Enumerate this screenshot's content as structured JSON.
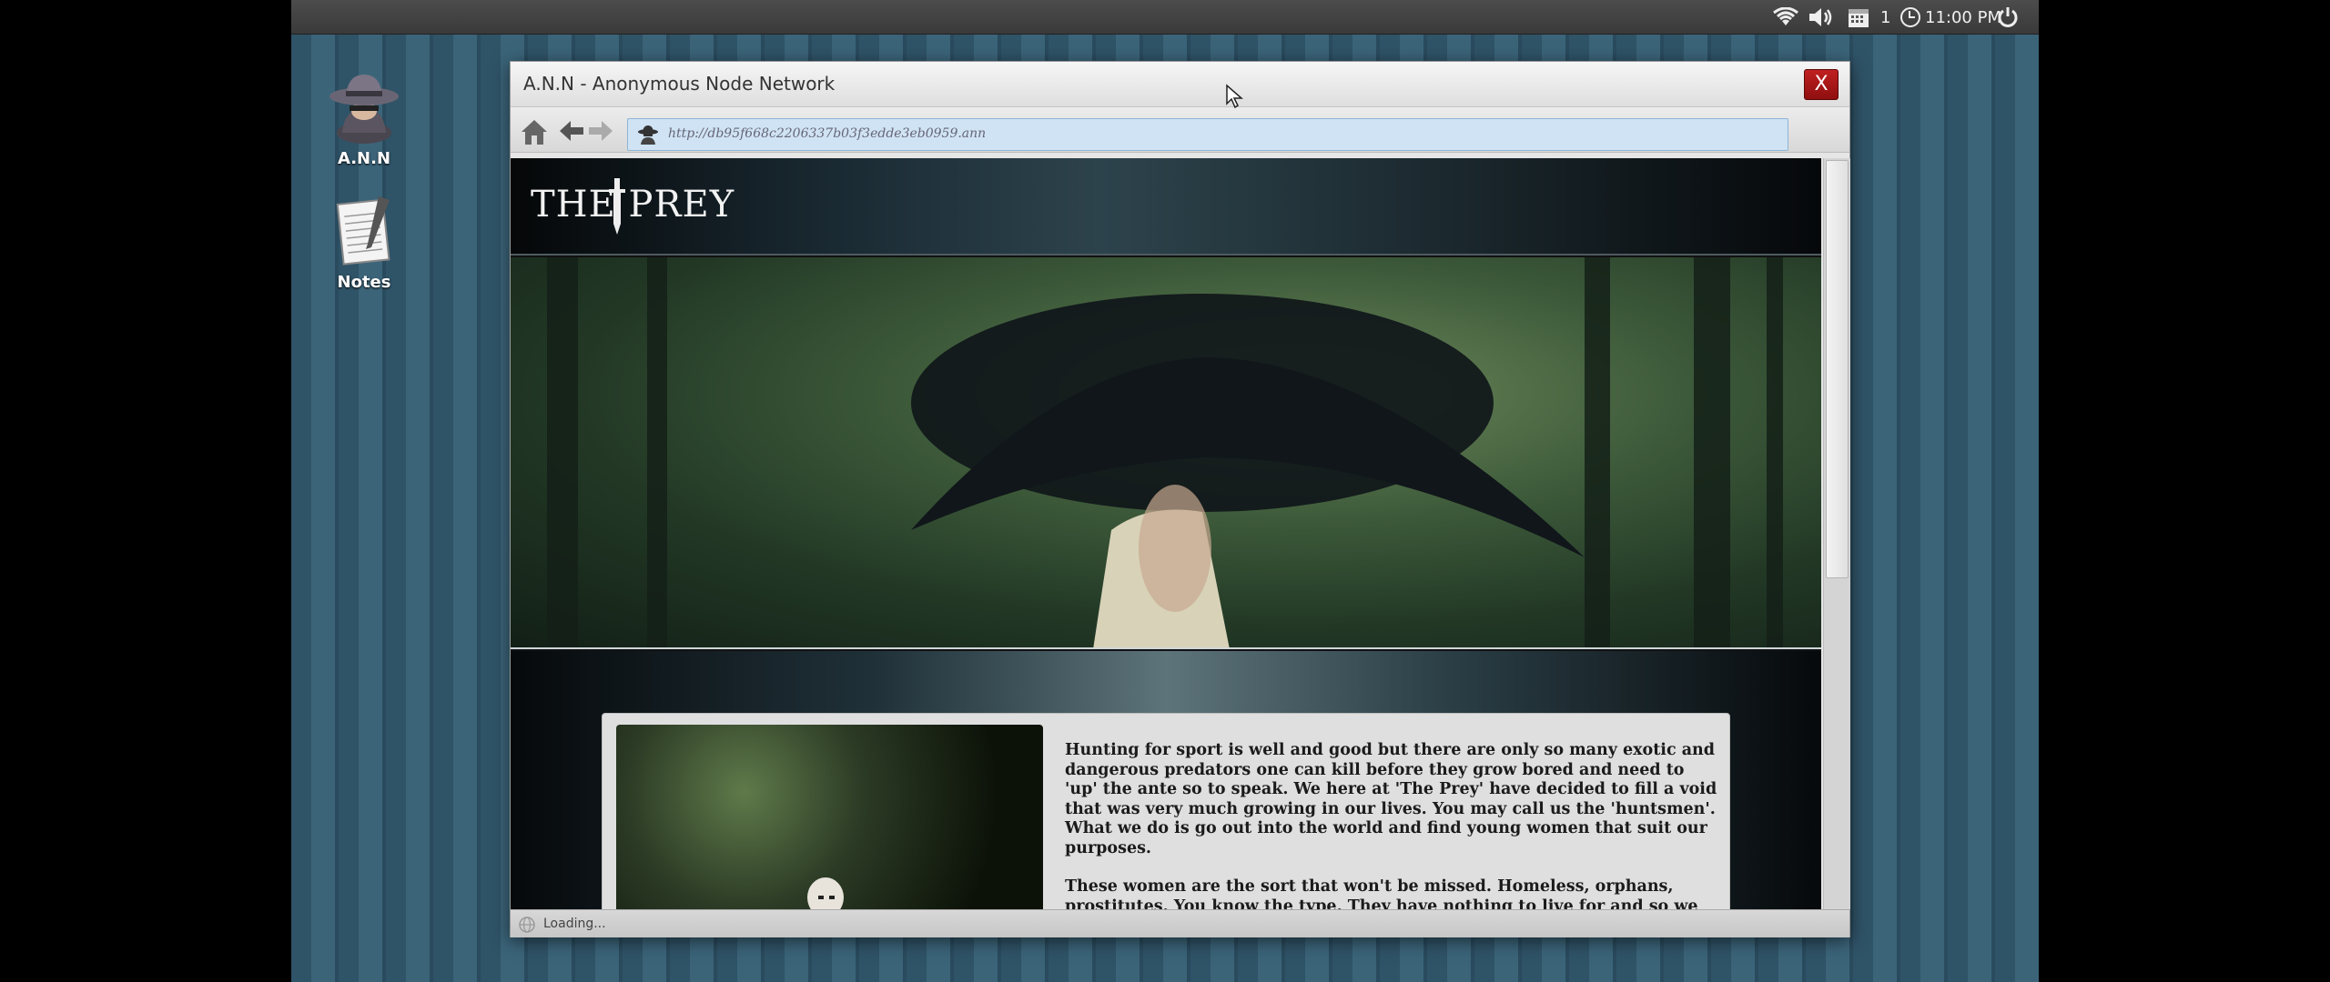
{
  "panel": {
    "workspace": "1",
    "clock": "11:00 PM"
  },
  "desktop": {
    "icons": [
      {
        "label": "A.N.N",
        "icon": "spy-hat-icon"
      },
      {
        "label": "Notes",
        "icon": "notepad-icon"
      }
    ]
  },
  "window": {
    "title": "A.N.N - Anonymous Node Network",
    "close_label": "X",
    "address": "http://db95f668c2206337b03f3edde3eb0959.ann",
    "status": "Loading..."
  },
  "site": {
    "logo": "THE PREY",
    "paragraphs": [
      "Hunting for sport is well and good but there are only so many exotic and dangerous predators one can kill before they grow bored and need to 'up' the ante so to speak. We here at 'The Prey' have decided to fill a void that was very much growing in our lives. You may call us the 'huntsmen'. What we do is go out into the world and find young women that suit our purposes.",
      "These women are the sort that won't be missed. Homeless, orphans, prostitutes. You know the type. They have nothing to live for and so we give them the chance to"
    ]
  },
  "colors": {
    "desktop_stripe": "#3b6479",
    "address_bar": "#cfe3f4",
    "close_button": "#b01818"
  }
}
